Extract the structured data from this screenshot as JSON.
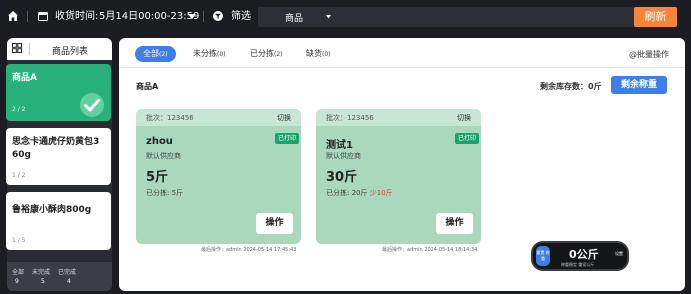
{
  "topbar": {
    "time_label": "收货时间:",
    "time_value": "5月14日00:00-23:59",
    "filter_label": "筛选",
    "select_value": "商品",
    "refresh_label": "刷新"
  },
  "sidebar": {
    "title": "商品列表",
    "items": [
      {
        "name": "商品A",
        "count": "2 / 2",
        "selected": true
      },
      {
        "name": "思念卡通虎仔奶黄包360g",
        "count": "1 / 2",
        "selected": false
      },
      {
        "name": "鲁裕康小酥肉800g",
        "count": "1 / 5",
        "selected": false
      }
    ],
    "stats": {
      "labels": [
        "全部",
        "未完成",
        "已完成"
      ],
      "values": [
        "9",
        "5",
        "4"
      ]
    }
  },
  "main": {
    "tabs": [
      {
        "label": "全部",
        "count": "(2)",
        "active": true
      },
      {
        "label": "未分拣",
        "count": "(0)",
        "active": false
      },
      {
        "label": "已分拣",
        "count": "(2)",
        "active": false
      },
      {
        "label": "缺货",
        "count": "(0)",
        "active": false
      }
    ],
    "batch_action_label": "@批量操作",
    "product_title": "商品A",
    "stock_label": "剩余库存数：0斤",
    "remaining_weigh_button": "剩余称重",
    "cards": [
      {
        "batch": "批次：123456",
        "switch_label": "切换",
        "customer": "zhou",
        "tag": "已打印",
        "supplier": "默认供应商",
        "weight": "5斤",
        "sorted_text": "已分拣: 5斤",
        "shortage_text": "",
        "action_label": "操作",
        "last_op": "最后操作：admin 2024-05-14 17:45:43"
      },
      {
        "batch": "批次：123456",
        "switch_label": "切换",
        "customer": "测试1",
        "tag": "已打印",
        "supplier": "默认供应商",
        "weight": "30斤",
        "sorted_text": "已分拣: 20斤",
        "shortage_text": "少10斤",
        "action_label": "操作",
        "last_op": "最后操作：admin 2024-05-14 18:14:34"
      }
    ]
  },
  "scale": {
    "left_label": "重置 称重",
    "value": "0公斤",
    "sub_label": "称重稳定 重设公斤",
    "right_label": "设置"
  },
  "colors": {
    "accent": "#3d7fe6",
    "refresh": "#f5853a",
    "selected_item": "#28b17b",
    "card_bg": "#a9d8bd",
    "tag_green": "#19a46b",
    "shortage_red": "#e53935"
  }
}
